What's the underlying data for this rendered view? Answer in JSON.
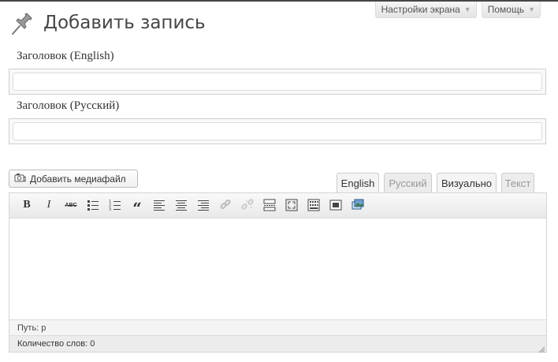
{
  "screen_options": {
    "settings_label": "Настройки экрана",
    "help_label": "Помощь",
    "arrow": "▼"
  },
  "page": {
    "title": "Добавить запись",
    "icon": "pushpin-icon"
  },
  "fields": {
    "title_english_label": "Заголовок (English)",
    "title_english_value": "",
    "title_russian_label": "Заголовок (Русский)",
    "title_russian_value": ""
  },
  "media": {
    "add_media_label": "Добавить медиафайл",
    "icon": "camera-music-icon"
  },
  "editor_tabs": {
    "english": "English",
    "russian": "Русский",
    "visual": "Визуально",
    "text": "Текст"
  },
  "toolbar": {
    "bold": "B",
    "italic": "I",
    "strikethrough": "ABC",
    "blockquote": "“",
    "icons": [
      "bold-icon",
      "italic-icon",
      "strikethrough-icon",
      "bullet-list-icon",
      "numbered-list-icon",
      "blockquote-icon",
      "align-left-icon",
      "align-center-icon",
      "align-right-icon",
      "insert-link-icon",
      "remove-link-icon",
      "insert-more-icon",
      "fullscreen-icon",
      "kitchen-sink-icon",
      "insert-block-icon",
      "insert-media-icon"
    ]
  },
  "status": {
    "path": "Путь: p",
    "word_count": "Количество слов: 0"
  },
  "colors": {
    "top_bar": "#464646",
    "border": "#cfcfcf",
    "toolbar_bg": "#eeeeee"
  }
}
